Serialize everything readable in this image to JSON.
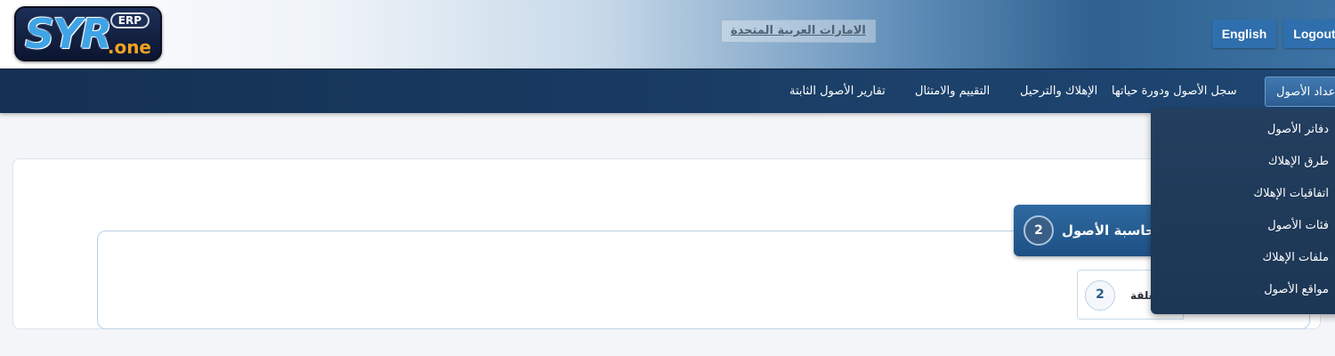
{
  "header": {
    "logo": {
      "main": "SYR",
      "badge": "ERP",
      "suffix": ".one"
    },
    "country": "الامارات العربية المتحدة",
    "english_label": "English",
    "logout_label": "Logout"
  },
  "nav": {
    "items": [
      {
        "label": "إعداد الأصول",
        "active": true
      },
      {
        "label": "سجل الأصول ودورة حياتها"
      },
      {
        "label": "الإهلاك والترحيل"
      },
      {
        "label": "التقييم والامتثال"
      },
      {
        "label": "تقارير الأصول الثابتة"
      }
    ]
  },
  "dropdown": {
    "items": [
      {
        "label": "دفاتر الأصول"
      },
      {
        "label": "طرق الإهلاك"
      },
      {
        "label": "اتفاقيات الإهلاك"
      },
      {
        "label": "فئات الأصول"
      },
      {
        "label": "ملفات الإهلاك"
      },
      {
        "label": "مواقع الأصول"
      }
    ]
  },
  "main": {
    "section": {
      "title": "محاسبة الأصول",
      "count": "2"
    },
    "sub": {
      "title": "المعلقة",
      "count": "2"
    }
  },
  "colors": {
    "nav_bg": "#18395f",
    "active_tab": "#3f78b0",
    "dropdown_bg": "#233e5e",
    "section_head": "#2d6aa1",
    "button": "#2f6fae"
  }
}
